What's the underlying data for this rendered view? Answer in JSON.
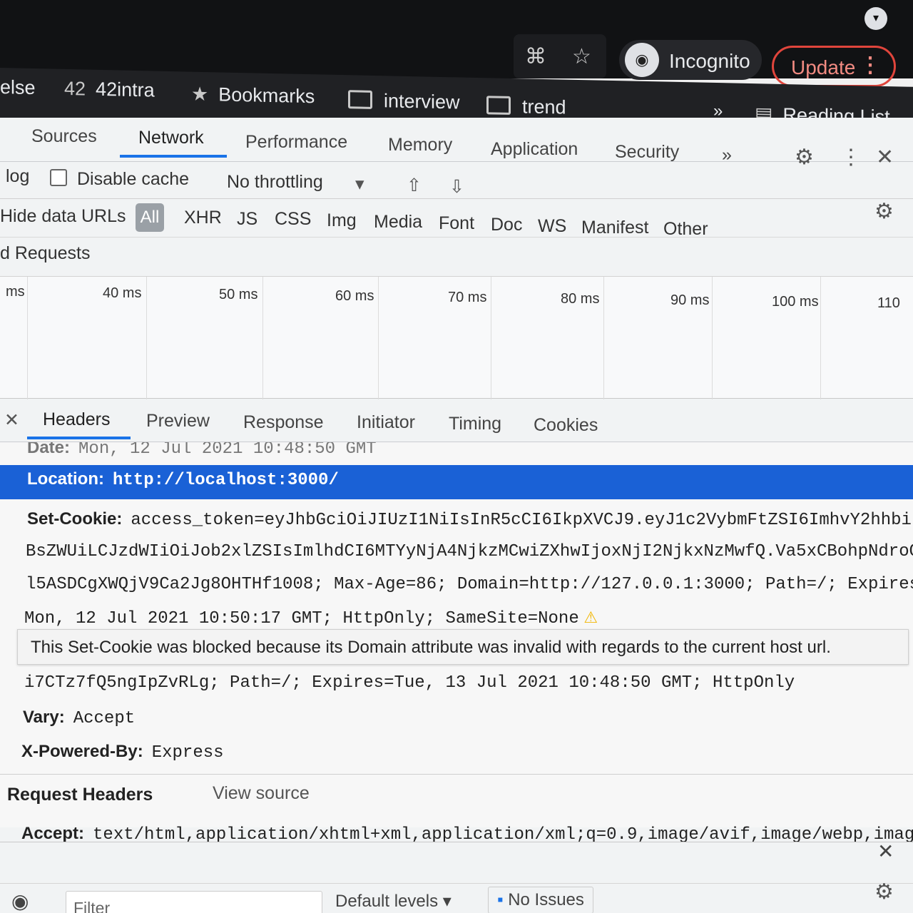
{
  "browser": {
    "incognito_label": "Incognito",
    "update_label": "Update",
    "bookmarks": [
      {
        "label": "else"
      },
      {
        "label": "42intra"
      },
      {
        "label": "Bookmarks"
      },
      {
        "label": "interview"
      },
      {
        "label": "trend"
      }
    ],
    "more_bookmarks": "»",
    "reading_list_label": "Reading List"
  },
  "devtools": {
    "tabs": [
      "Sources",
      "Network",
      "Performance",
      "Memory",
      "Application",
      "Security"
    ],
    "active_tab": "Network",
    "overflow": "»",
    "toolbar": {
      "preserve_log": "log",
      "disable_cache": "Disable cache",
      "throttling": "No throttling"
    },
    "filters": {
      "hide_data_urls": "Hide data URLs",
      "types": [
        "All",
        "XHR",
        "JS",
        "CSS",
        "Img",
        "Media",
        "Font",
        "Doc",
        "WS",
        "Manifest",
        "Other"
      ]
    },
    "blocked_requests": "d Requests",
    "timeline_ticks": [
      "ms",
      "40 ms",
      "50 ms",
      "60 ms",
      "70 ms",
      "80 ms",
      "90 ms",
      "100 ms",
      "110"
    ],
    "detail_tabs": [
      "Headers",
      "Preview",
      "Response",
      "Initiator",
      "Timing",
      "Cookies"
    ],
    "headers": {
      "date_key": "Date:",
      "date_val": "Mon, 12 Jul 2021 10:48:50 GMT",
      "location_key": "Location:",
      "location_val": "http://localhost:3000/",
      "setcookie_key": "Set-Cookie:",
      "setcookie_line1": "access_token=eyJhbGciOiJIUzI1NiIsInR5cCI6IkpXVCJ9.eyJ1c2VybmFtZSI6ImhvY2hhbi",
      "setcookie_line2": "BsZWUiLCJzdWIiOiJob2xlZSIsImlhdCI6MTYyNjA4NjkzMCwiZXhwIjoxNjI2NjkxNzMwfQ.Va5xCBohpNdroOP",
      "setcookie_line3": "l5ASDCgXWQjV9Ca2Jg8OHTHf1008; Max-Age=86; Domain=http://127.0.0.1:3000; Path=/; Expires=",
      "setcookie_line4": "Mon, 12 Jul 2021 10:50:17 GMT; HttpOnly; SameSite=None",
      "warning": "This Set-Cookie was blocked because its Domain attribute was invalid with regards to the current host url.",
      "setcookie_line5": "i7CTz7fQ5ngIpZvRLg; Path=/; Expires=Tue, 13 Jul 2021 10:48:50 GMT; HttpOnly",
      "vary_key": "Vary:",
      "vary_val": "Accept",
      "powered_key": "X-Powered-By:",
      "powered_val": "Express"
    },
    "request_headers": {
      "title": "Request Headers",
      "view_source": "View source",
      "accept_key": "Accept:",
      "accept_val": "text/html,application/xhtml+xml,application/xml;q=0.9,image/avif,image/webp,imag"
    },
    "console": {
      "filter_placeholder": "Filter",
      "levels": "Default levels",
      "issues": "No Issues"
    }
  }
}
